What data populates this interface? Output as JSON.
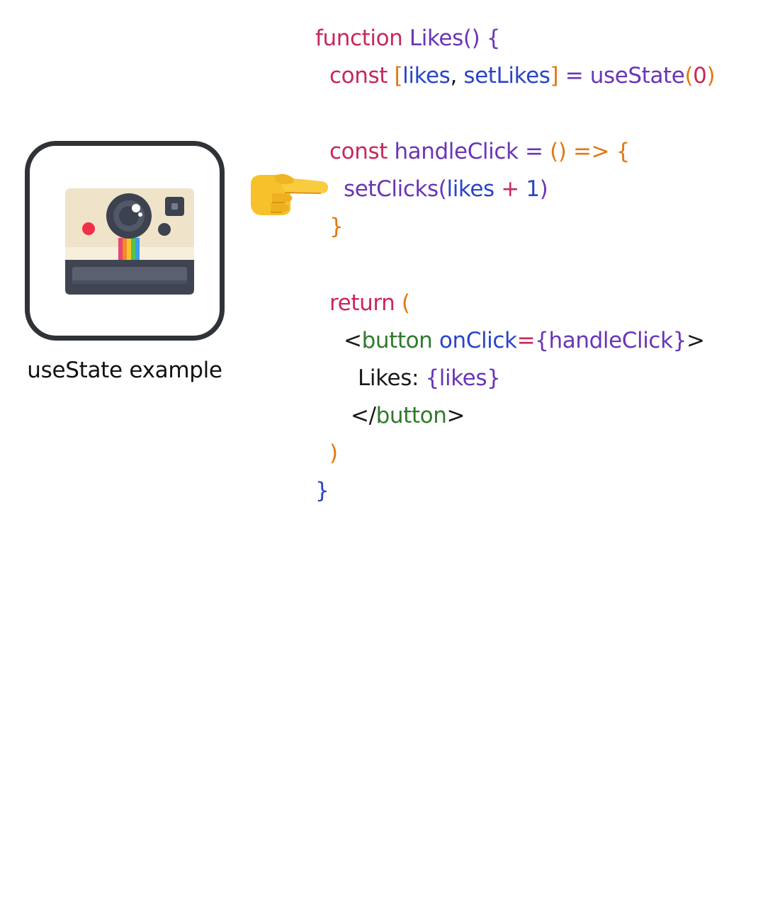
{
  "caption": "useState example",
  "icon": "instant-camera-icon",
  "pointer_icon": "backhand-index-pointing-right-icon",
  "code": {
    "line1": {
      "kw": "function",
      "name": "Likes",
      "parens": "()",
      "brace": "{"
    },
    "line2": {
      "kw": "const",
      "open_bracket": "[",
      "var1": "likes",
      "comma": ",",
      "var2": "setLikes",
      "close_bracket": "]",
      "eq": "=",
      "call": "useState",
      "open_paren": "(",
      "arg": "0",
      "close_paren": ")"
    },
    "line3": {
      "kw": "const",
      "name": "handleClick",
      "eq": "=",
      "parens": "()",
      "arrow": "=>",
      "brace": "{"
    },
    "line4": {
      "call": "setClicks",
      "open_paren": "(",
      "var": "likes",
      "op": "+",
      "num": "1",
      "close_paren": ")"
    },
    "line5": {
      "brace": "}"
    },
    "line6": {
      "kw": "return",
      "paren": "("
    },
    "line7": {
      "lt": "<",
      "tag": "button",
      "attr": "onClick",
      "eq": "=",
      "open_brace": "{",
      "value": "handleClick",
      "close_brace": "}",
      "gt": ">"
    },
    "line8": {
      "text": "Likes:",
      "open_brace": "{",
      "var": "likes",
      "close_brace": "}"
    },
    "line9": {
      "lt": "</",
      "tag": "button",
      "gt": ">"
    },
    "line10": {
      "paren": ")"
    },
    "line11": {
      "brace": "}"
    }
  },
  "colors": {
    "keyword": "#c8285a",
    "function": "#6a35b8",
    "identifier": "#2a45c9",
    "bracket": "#e07a13",
    "tag": "#2f7a2c",
    "plain": "#1a1a1a",
    "icon_border": "#2f3236"
  }
}
